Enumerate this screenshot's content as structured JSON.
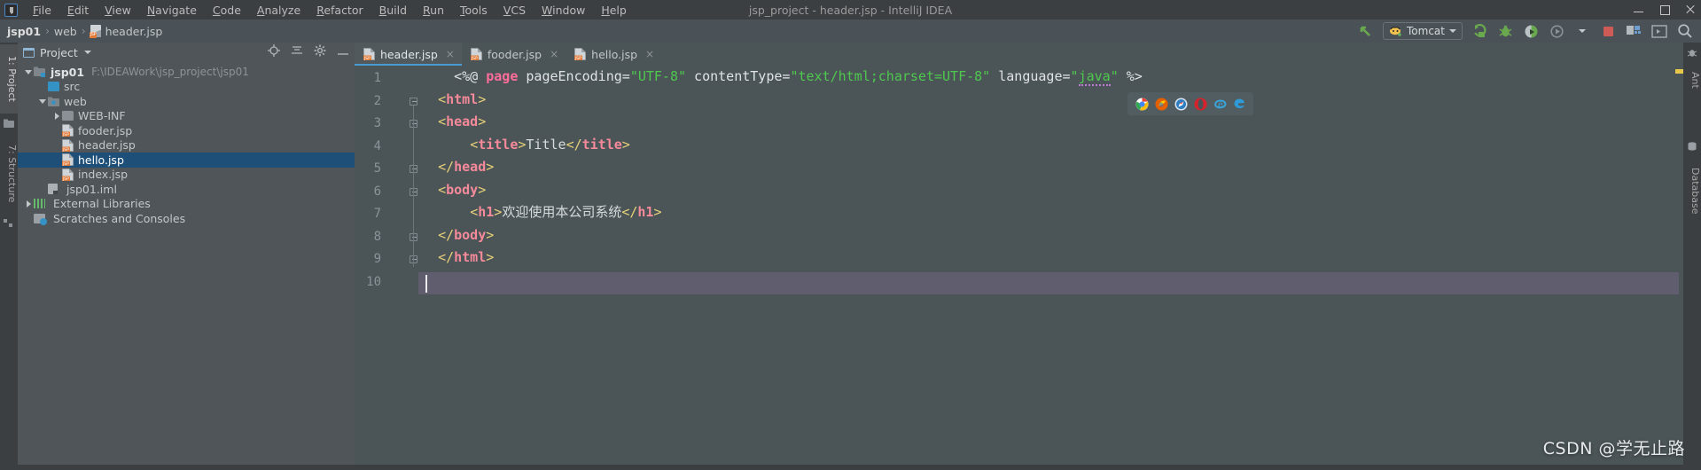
{
  "window": {
    "title": "jsp_project - header.jsp - IntelliJ IDEA",
    "logo": "intellij-idea-logo",
    "minimize": "minimize-icon",
    "maximize": "maximize-icon",
    "close": "close-icon"
  },
  "menu": {
    "items": [
      {
        "label": "File"
      },
      {
        "label": "Edit"
      },
      {
        "label": "View"
      },
      {
        "label": "Navigate"
      },
      {
        "label": "Code"
      },
      {
        "label": "Analyze"
      },
      {
        "label": "Refactor"
      },
      {
        "label": "Build"
      },
      {
        "label": "Run"
      },
      {
        "label": "Tools"
      },
      {
        "label": "VCS"
      },
      {
        "label": "Window"
      },
      {
        "label": "Help"
      }
    ]
  },
  "breadcrumb": {
    "project": "jsp01",
    "folder": "web",
    "file": "header.jsp",
    "separator": "›"
  },
  "toolbar": {
    "back_arrow": "green-arrow-icon",
    "run_config": "Tomcat",
    "run_config_icon": "tomcat-icon",
    "dropdown_icon": "chevron-down-icon",
    "buttons": [
      {
        "name": "run-button",
        "icon": "run-icon",
        "color": "#6aa84f"
      },
      {
        "name": "debug-button",
        "icon": "bug-icon",
        "color": "#6aa84f"
      },
      {
        "name": "run-with-coverage-button",
        "icon": "coverage-icon",
        "color": "#6aa84f"
      },
      {
        "name": "profile-button",
        "icon": "profile-icon",
        "color": "#8a9296"
      },
      {
        "name": "stop-button",
        "icon": "stop-square-icon",
        "color": "#cf5b56"
      },
      {
        "name": "build-project-button",
        "icon": "build-icon",
        "color": "#6e9dd0"
      },
      {
        "name": "terminal-button",
        "icon": "terminal-icon",
        "color": "#a8afb3"
      },
      {
        "name": "search-everywhere-button",
        "icon": "search-icon",
        "color": "#b9c0c4"
      }
    ]
  },
  "left_strip": {
    "project_label": "1: Project",
    "structure_label": "7: Structure"
  },
  "right_strip": {
    "ant_label": "Ant",
    "database_label": "Database"
  },
  "project_panel": {
    "title": "Project",
    "dropdown_icon": "chevron-down-icon",
    "actions": [
      {
        "name": "locate-icon",
        "label": "⊕"
      },
      {
        "name": "collapse-all-icon",
        "label": "≡"
      },
      {
        "name": "settings-gear-icon",
        "label": "⚙"
      },
      {
        "name": "hide-panel-icon",
        "label": "—"
      }
    ],
    "tree": [
      {
        "label": "jsp01",
        "path": "F:\\IDEAWork\\jsp_project\\jsp01",
        "indent": 0,
        "arrow": "down",
        "icon": "module-folder-icon",
        "bold": true,
        "selected": false
      },
      {
        "label": "src",
        "path": "",
        "indent": 1,
        "arrow": "none",
        "icon": "source-folder-icon",
        "bold": false,
        "selected": false
      },
      {
        "label": "web",
        "path": "",
        "indent": 1,
        "arrow": "down",
        "icon": "web-folder-icon",
        "bold": false,
        "selected": false
      },
      {
        "label": "WEB-INF",
        "path": "",
        "indent": 2,
        "arrow": "right",
        "icon": "folder-icon",
        "bold": false,
        "selected": false
      },
      {
        "label": "fooder.jsp",
        "path": "",
        "indent": 2,
        "arrow": "none",
        "icon": "jsp-file-icon",
        "bold": false,
        "selected": false
      },
      {
        "label": "header.jsp",
        "path": "",
        "indent": 2,
        "arrow": "none",
        "icon": "jsp-file-icon",
        "bold": false,
        "selected": false
      },
      {
        "label": "hello.jsp",
        "path": "",
        "indent": 2,
        "arrow": "none",
        "icon": "jsp-file-icon",
        "bold": false,
        "selected": true
      },
      {
        "label": "index.jsp",
        "path": "",
        "indent": 2,
        "arrow": "none",
        "icon": "jsp-file-icon",
        "bold": false,
        "selected": false
      },
      {
        "label": "jsp01.iml",
        "path": "",
        "indent": 1,
        "arrow": "none",
        "icon": "iml-file-icon",
        "bold": false,
        "selected": false
      },
      {
        "label": "External Libraries",
        "path": "",
        "indent": 0,
        "arrow": "right",
        "icon": "libraries-icon",
        "bold": false,
        "selected": false
      },
      {
        "label": "Scratches and Consoles",
        "path": "",
        "indent": 0,
        "arrow": "none",
        "icon": "scratches-icon",
        "bold": false,
        "selected": false
      }
    ]
  },
  "editor": {
    "tabs": [
      {
        "label": "header.jsp",
        "icon": "jsp-file-icon",
        "active": true,
        "close": "×"
      },
      {
        "label": "fooder.jsp",
        "icon": "jsp-file-icon",
        "active": false,
        "close": "×"
      },
      {
        "label": "hello.jsp",
        "icon": "jsp-file-icon",
        "active": false,
        "close": "×"
      }
    ],
    "caret_line": 10,
    "lines": [
      {
        "num": "1",
        "fold": "none",
        "tokens": [
          {
            "t": "    ",
            "c": "plain"
          },
          {
            "t": "<%@ ",
            "c": "plain"
          },
          {
            "t": "page",
            "c": "kw"
          },
          {
            "t": " pageEncoding=",
            "c": "plain"
          },
          {
            "t": "\"UTF-8\"",
            "c": "str"
          },
          {
            "t": " contentType=",
            "c": "plain"
          },
          {
            "t": "\"text/html;charset=UTF-8\"",
            "c": "str"
          },
          {
            "t": " language=",
            "c": "plain"
          },
          {
            "t": "\"",
            "c": "str"
          },
          {
            "t": "java",
            "c": "str-squig"
          },
          {
            "t": "\"",
            "c": "str"
          },
          {
            "t": " %>",
            "c": "plain"
          }
        ]
      },
      {
        "num": "2",
        "fold": "start",
        "tokens": [
          {
            "t": "  ",
            "c": "plain"
          },
          {
            "t": "<",
            "c": "br"
          },
          {
            "t": "html",
            "c": "tag"
          },
          {
            "t": ">",
            "c": "br"
          }
        ]
      },
      {
        "num": "3",
        "fold": "start",
        "tokens": [
          {
            "t": "  ",
            "c": "plain"
          },
          {
            "t": "<",
            "c": "br"
          },
          {
            "t": "head",
            "c": "tag"
          },
          {
            "t": ">",
            "c": "br"
          }
        ]
      },
      {
        "num": "4",
        "fold": "none",
        "tokens": [
          {
            "t": "      ",
            "c": "plain"
          },
          {
            "t": "<",
            "c": "br"
          },
          {
            "t": "title",
            "c": "tag"
          },
          {
            "t": ">",
            "c": "br"
          },
          {
            "t": "Title",
            "c": "txt"
          },
          {
            "t": "</",
            "c": "br"
          },
          {
            "t": "title",
            "c": "tag"
          },
          {
            "t": ">",
            "c": "br"
          }
        ]
      },
      {
        "num": "5",
        "fold": "end",
        "tokens": [
          {
            "t": "  ",
            "c": "plain"
          },
          {
            "t": "</",
            "c": "br"
          },
          {
            "t": "head",
            "c": "tag"
          },
          {
            "t": ">",
            "c": "br"
          }
        ]
      },
      {
        "num": "6",
        "fold": "start",
        "tokens": [
          {
            "t": "  ",
            "c": "plain"
          },
          {
            "t": "<",
            "c": "br"
          },
          {
            "t": "body",
            "c": "tag"
          },
          {
            "t": ">",
            "c": "br"
          }
        ]
      },
      {
        "num": "7",
        "fold": "none",
        "tokens": [
          {
            "t": "      ",
            "c": "plain"
          },
          {
            "t": "<",
            "c": "br"
          },
          {
            "t": "h1",
            "c": "tag"
          },
          {
            "t": ">",
            "c": "br"
          },
          {
            "t": "欢迎使用本公司系统",
            "c": "txt"
          },
          {
            "t": "</",
            "c": "br"
          },
          {
            "t": "h1",
            "c": "tag"
          },
          {
            "t": ">",
            "c": "br"
          }
        ]
      },
      {
        "num": "8",
        "fold": "end",
        "tokens": [
          {
            "t": "  ",
            "c": "plain"
          },
          {
            "t": "</",
            "c": "br"
          },
          {
            "t": "body",
            "c": "tag"
          },
          {
            "t": ">",
            "c": "br"
          }
        ]
      },
      {
        "num": "9",
        "fold": "end",
        "tokens": [
          {
            "t": "  ",
            "c": "plain"
          },
          {
            "t": "</",
            "c": "br"
          },
          {
            "t": "html",
            "c": "tag"
          },
          {
            "t": ">",
            "c": "br"
          }
        ]
      },
      {
        "num": "10",
        "fold": "none",
        "tokens": []
      }
    ]
  },
  "browser_popup": {
    "browsers": [
      {
        "name": "chrome-icon",
        "color": "#4285f4"
      },
      {
        "name": "firefox-icon",
        "color": "#e66000"
      },
      {
        "name": "safari-icon",
        "color": "#4a9ad4"
      },
      {
        "name": "opera-icon",
        "color": "#d6222a"
      },
      {
        "name": "internet-explorer-icon",
        "color": "#3aa3d8"
      },
      {
        "name": "edge-icon",
        "color": "#2d9bd8"
      }
    ]
  },
  "watermark": {
    "text": "CSDN @学无止路"
  },
  "colors": {
    "accent": "#4a9ad4",
    "selection": "#1e4f78",
    "string": "#4ec94e",
    "keyword": "#ff6e9a",
    "tag": "#f58a9a",
    "bracket": "#e8d17a",
    "run_green": "#6aa84f",
    "stop_red": "#cf5b56"
  }
}
